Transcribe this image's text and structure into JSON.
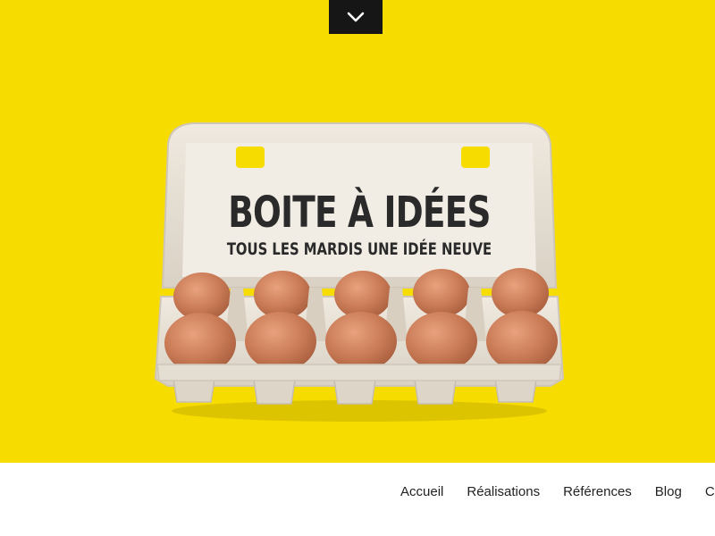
{
  "hero": {
    "title": "BOITE À IDÉES",
    "subtitle": "TOUS LES MARDIS UNE IDÉE NEUVE",
    "background": "#f7dc00",
    "scroll_button_icon": "chevron-down-icon"
  },
  "nav": {
    "items": [
      {
        "label": "Accueil"
      },
      {
        "label": "Réalisations"
      },
      {
        "label": "Références"
      },
      {
        "label": "Blog"
      },
      {
        "label": "C"
      }
    ]
  }
}
